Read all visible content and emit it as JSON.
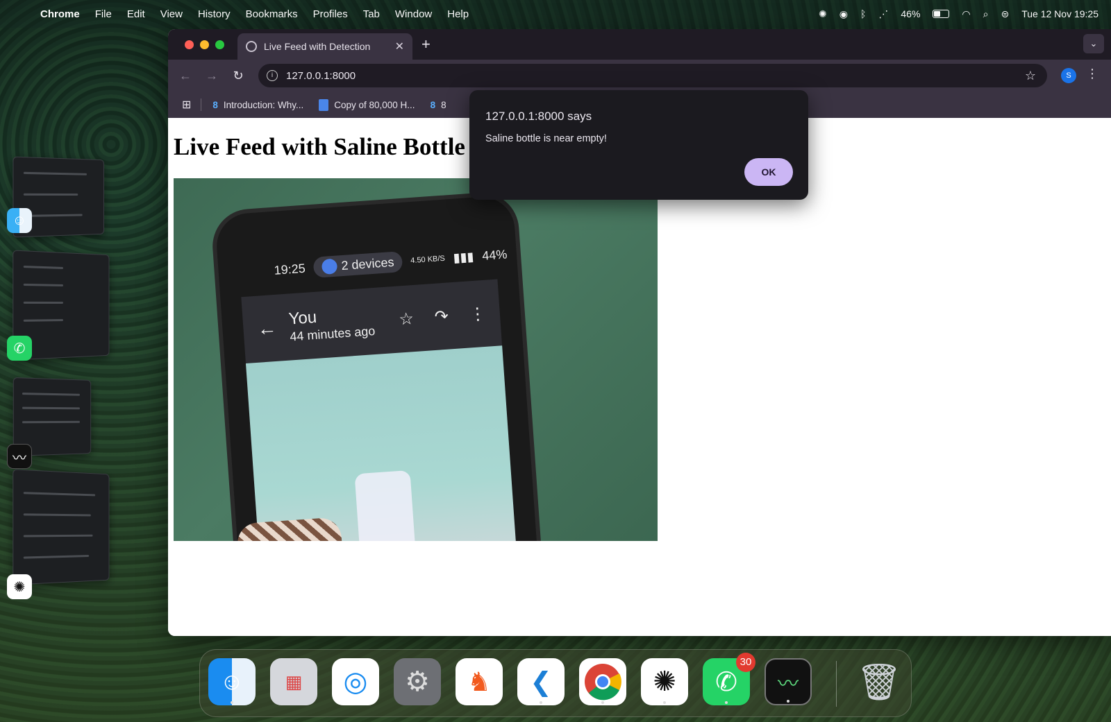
{
  "menubar": {
    "app": "Chrome",
    "items": [
      "File",
      "Edit",
      "View",
      "History",
      "Bookmarks",
      "Profiles",
      "Tab",
      "Window",
      "Help"
    ],
    "battery": "46%",
    "battery_level": 0.46,
    "datetime": "Tue 12 Nov  19:25"
  },
  "browser": {
    "tab_title": "Live Feed with Detection",
    "url": "127.0.0.1:8000",
    "profile_initial": "S",
    "bookmarks": [
      {
        "label": "Introduction: Why...",
        "icon": "8"
      },
      {
        "label": "Copy of 80,000 H...",
        "icon": "doc"
      },
      {
        "label": "8",
        "icon": "8"
      }
    ]
  },
  "page": {
    "heading": "Live Feed with Saline Bottle"
  },
  "video": {
    "status_time": "19:25",
    "devices": "2 devices",
    "network": "4.50 KB/S",
    "battery": "44%",
    "chat_title": "You",
    "chat_subtitle": "44 minutes ago"
  },
  "dialog": {
    "title": "127.0.0.1:8000 says",
    "message": "Saline bottle is near empty!",
    "ok_label": "OK"
  },
  "dock": {
    "apps": [
      {
        "name": "Finder",
        "icon": "finder-icon"
      },
      {
        "name": "Launchpad",
        "icon": "launchpad-icon"
      },
      {
        "name": "Safari",
        "icon": "safari-icon"
      },
      {
        "name": "System Settings",
        "icon": "settings-icon"
      },
      {
        "name": "Brave",
        "icon": "brave-icon"
      },
      {
        "name": "VS Code",
        "icon": "vscode-icon"
      },
      {
        "name": "Chrome",
        "icon": "chrome-icon"
      },
      {
        "name": "ChatGPT",
        "icon": "chatgpt-icon"
      },
      {
        "name": "WhatsApp",
        "icon": "whatsapp-icon"
      },
      {
        "name": "Activity Monitor",
        "icon": "activity-monitor-icon"
      },
      {
        "name": "Trash",
        "icon": "trash-icon"
      }
    ],
    "whatsapp_badge": "30"
  },
  "colors": {
    "dialog_ok": "#cbb6f4",
    "tab_active": "#3a3342",
    "tab_strip": "#1f1b24"
  }
}
